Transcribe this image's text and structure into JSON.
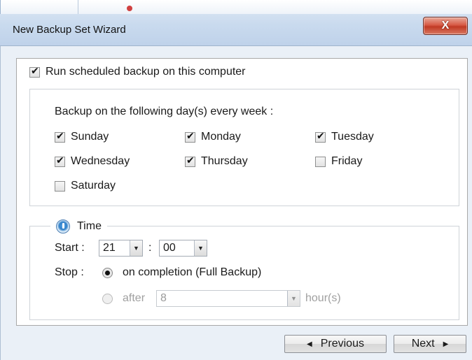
{
  "window": {
    "title": "New Backup Set Wizard",
    "close_glyph": "X"
  },
  "schedule": {
    "run_label": "Run scheduled backup on this computer",
    "run_checked": true,
    "days_heading": "Backup on the following day(s) every week :",
    "days": [
      {
        "label": "Sunday",
        "checked": true
      },
      {
        "label": "Monday",
        "checked": true
      },
      {
        "label": "Tuesday",
        "checked": true
      },
      {
        "label": "Wednesday",
        "checked": true
      },
      {
        "label": "Thursday",
        "checked": true
      },
      {
        "label": "Friday",
        "checked": false
      },
      {
        "label": "Saturday",
        "checked": false
      }
    ]
  },
  "time": {
    "legend": "Time",
    "start_label": "Start :",
    "start_hour": "21",
    "separator": ":",
    "start_minute": "00",
    "stop_label": "Stop :",
    "on_completion_label": "on completion (Full Backup)",
    "after_label": "after",
    "after_value": "8",
    "hours_label": "hour(s)"
  },
  "buttons": {
    "previous": "Previous",
    "next": "Next"
  },
  "icons": {
    "close": "close-icon",
    "prev": "triangle-left-icon",
    "next": "triangle-right-icon",
    "dropdown": "chevron-down-icon",
    "time": "clock-radio-icon"
  },
  "colors": {
    "close_button": "#c13a24",
    "dialog_background": "#eaf0f7",
    "accent_radio": "#2f7fc7"
  }
}
